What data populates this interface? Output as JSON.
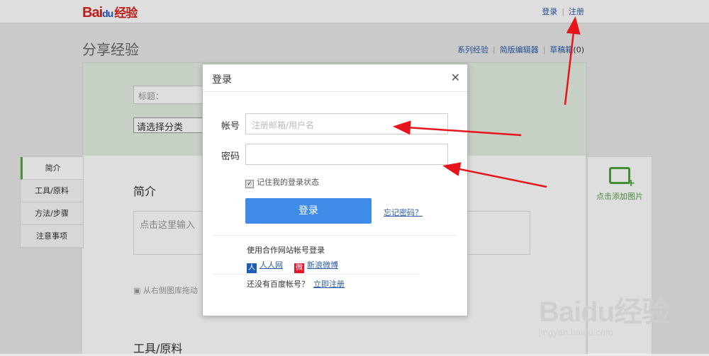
{
  "header": {
    "logo_text": "Bai",
    "logo_paw": "du",
    "logo_cn": "经验",
    "login_link": "登录",
    "register_link": "注册"
  },
  "page": {
    "title": "分享经验",
    "links": [
      "系列经验",
      "简版编辑器",
      "草稿箱"
    ],
    "draft_count": "(0)",
    "title_field_placeholder": "标题：",
    "category_select": "请选择分类",
    "intro_heading": "简介",
    "intro_placeholder": "点击这里输入",
    "image_hint": "从右侧图库拖动",
    "tools_heading": "工具/原料",
    "add_image_label": "点击添加图片"
  },
  "left_nav": {
    "items": [
      "简介",
      "工具/原料",
      "方法/步骤",
      "注意事项"
    ]
  },
  "modal": {
    "title": "登录",
    "close_icon": "close-icon",
    "account_label": "帐号",
    "account_placeholder": "注册邮箱/用户名",
    "password_label": "密码",
    "remember_label": "记住我的登录状态",
    "remember_checked": true,
    "login_button": "登录",
    "forgot_link": "忘记密码？",
    "partner_title": "使用合作网站帐号登录",
    "partners": [
      "人人网",
      "新浪微博"
    ],
    "no_account_text": "还没有百度帐号？",
    "register_now": "立即注册"
  },
  "watermark": {
    "logo": "Baidu经验",
    "url": "jingyan.baidu.com"
  },
  "colors": {
    "baidu_red": "#d8241d",
    "baidu_blue": "#2553c7",
    "login_button": "#3f8be8",
    "link_blue": "#2b5ca8",
    "annotation_arrow": "#e8141b",
    "green_accent": "#58a648"
  }
}
